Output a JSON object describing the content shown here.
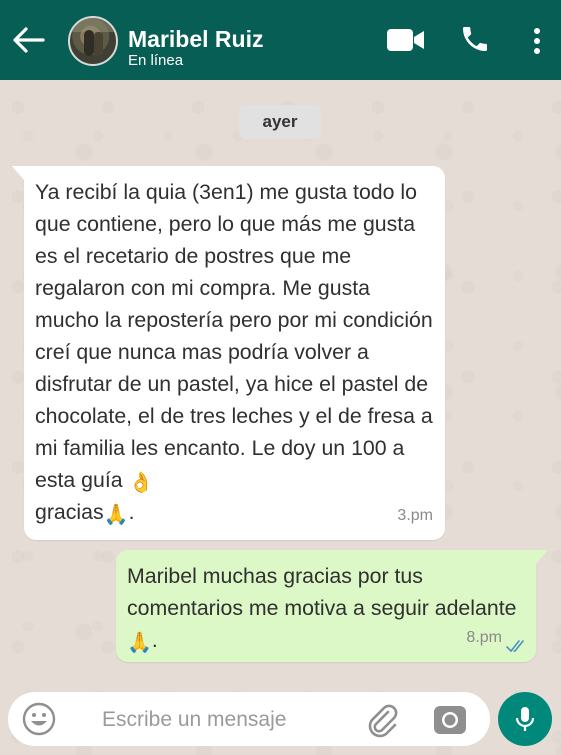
{
  "header": {
    "contact_name": "Maribel Ruiz",
    "status": "En línea",
    "colors": {
      "bar": "#075e54",
      "text": "#ffffff"
    }
  },
  "icons": {
    "back": "arrow-left-icon",
    "video": "video-camera-icon",
    "phone": "phone-icon",
    "menu": "more-vertical-icon",
    "emoji": "emoji-icon",
    "attach": "paperclip-icon",
    "camera": "camera-icon",
    "mic": "microphone-icon",
    "read": "double-check-icon"
  },
  "chat": {
    "date_chip": "ayer",
    "messages": [
      {
        "direction": "incoming",
        "text": "Ya recibí la quia (3en1) me gusta todo lo que contiene, pero lo que más me gusta es el recetario de postres que me regalaron con mi compra. Me gusta mucho la repostería pero por mi condición creí que nunca mas podría volver a disfrutar de un pastel, ya hice el pastel de chocolate, el de tres leches y el de fresa a mi familia les encanto. Le doy un 100 a esta guía",
        "emoji_1": "👌",
        "text_2": "gracias",
        "emoji_2": "🙏",
        "text_end": ".",
        "time": "3.pm",
        "bubble_color": "#ffffff"
      },
      {
        "direction": "outgoing",
        "text": "Maribel muchas gracias por tus comentarios me motiva a seguir adelante",
        "emoji_1": "🙏",
        "text_end": ".",
        "time": "8.pm",
        "bubble_color": "#dcf8c6",
        "read": true
      }
    ]
  },
  "composer": {
    "placeholder": "Escribe un mensaje",
    "mic_color": "#00897b"
  }
}
